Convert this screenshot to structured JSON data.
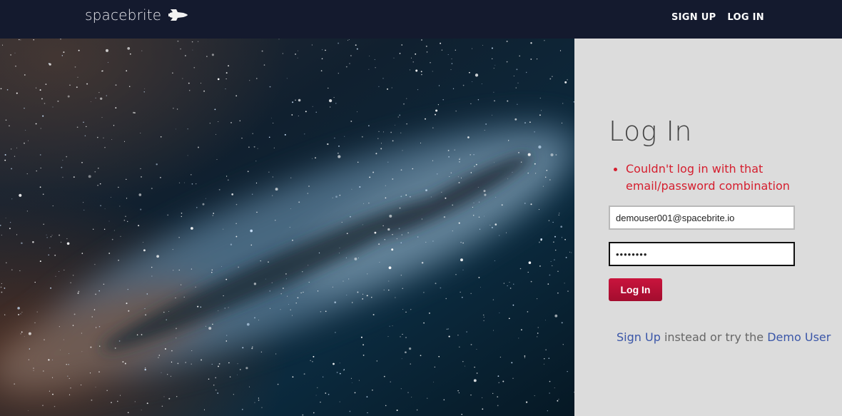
{
  "header": {
    "brand": "spacebrite",
    "brand_icon": "space-shuttle-icon",
    "nav": {
      "signup": "SIGN UP",
      "login": "LOG IN"
    }
  },
  "hero": {
    "image": "starry-night-sky"
  },
  "login": {
    "title": "Log In",
    "errors": [
      "Couldn't log in with that email/password combination"
    ],
    "email_value": "demouser001@spacebrite.io",
    "password_value": "••••••••",
    "submit_label": "Log In"
  },
  "footer": {
    "signup_link": "Sign Up",
    "middle_text": " instead or try the ",
    "demo_link": "Demo User"
  },
  "colors": {
    "header_bg": "#141a2e",
    "panel_bg": "#dcdcdc",
    "error": "#d51e2e",
    "button": "#c9143d",
    "link": "#3a56a8"
  }
}
